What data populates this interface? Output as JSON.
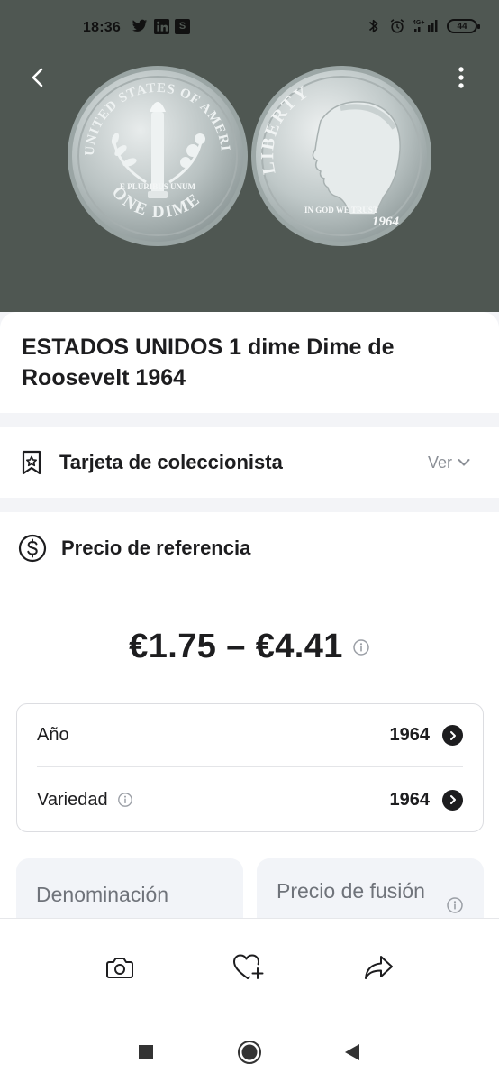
{
  "status_bar": {
    "time": "18:36",
    "app_badge": "S",
    "network": "4G+",
    "battery": "44"
  },
  "coin": {
    "title": "ESTADOS UNIDOS 1 dime Dime de Roosevelt 1964",
    "obverse_legend": "LIBERTY",
    "obverse_motto": "IN GOD WE TRUST",
    "obverse_year": "1964",
    "reverse_legend": "UNITED STATES OF AMERICA",
    "reverse_motto": "E PLURIBUS UNUM",
    "reverse_denomination": "ONE DIME"
  },
  "collector_card": {
    "label": "Tarjeta de coleccionista",
    "view_label": "Ver"
  },
  "reference_price": {
    "label": "Precio de referencia",
    "range": "€1.75 – €4.41"
  },
  "details": [
    {
      "label": "Año",
      "value": "1964",
      "has_info": false
    },
    {
      "label": "Variedad",
      "value": "1964",
      "has_info": true
    }
  ],
  "tiles": [
    {
      "label": "Denominación"
    },
    {
      "label": "Precio de fusión"
    }
  ],
  "colors": {
    "hero_bg": "#4f5752",
    "page_bg": "#f3f4f7",
    "text_primary": "#1d1d1f",
    "text_muted": "#8b8f96",
    "tile_bg": "#f2f4f8"
  },
  "icons": {
    "back": "chevron-left-icon",
    "more": "more-vertical-icon",
    "collector": "bookmark-star-icon",
    "price": "dollar-circle-icon",
    "info": "info-icon",
    "camera": "camera-icon",
    "favorite": "heart-plus-icon",
    "share": "share-icon"
  }
}
